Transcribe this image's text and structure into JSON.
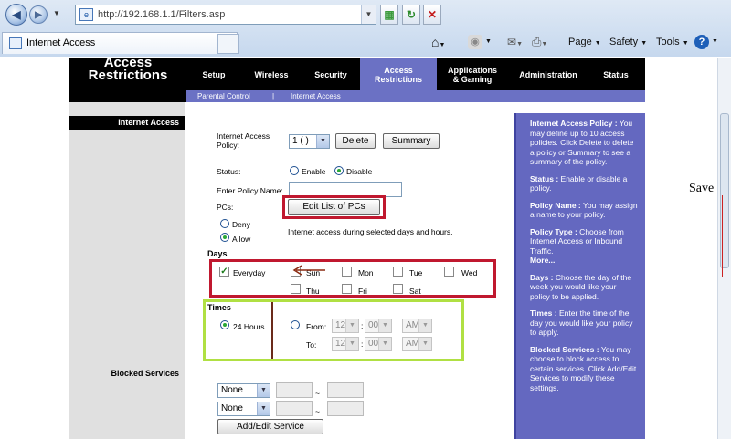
{
  "browser": {
    "address": "http://192.168.1.1/Filters.asp",
    "address_host": "http://192.168.1.1/",
    "address_path": "Filters.asp",
    "tab_title": "Internet Access",
    "commands": {
      "page": "Page",
      "safety": "Safety",
      "tools": "Tools",
      "help": "?"
    }
  },
  "router": {
    "section_title": "Access Restrictions",
    "tabs": [
      {
        "label": "Setup"
      },
      {
        "label": "Wireless"
      },
      {
        "label": "Security"
      },
      {
        "label": "Access Restrictions",
        "active": true
      },
      {
        "label": "Applications & Gaming"
      },
      {
        "label": "Administration"
      },
      {
        "label": "Status"
      }
    ],
    "subtabs": [
      "Parental Control",
      "|",
      "Internet Access"
    ],
    "side_label": "Internet Access",
    "blocked_services_label": "Blocked Services"
  },
  "form": {
    "policy_label": "Internet Access Policy:",
    "policy_value": "1 ( )",
    "delete_label": "Delete",
    "summary_label": "Summary",
    "status_label": "Status:",
    "enable_label": "Enable",
    "disable_label": "Disable",
    "status_selected": "Disable",
    "policy_name_label": "Enter Policy Name:",
    "policy_name_value": "",
    "pcs_label": "PCs:",
    "edit_pcs_label": "Edit List of PCs",
    "deny_label": "Deny",
    "allow_label": "Allow",
    "access_selected": "Allow",
    "access_note": "Internet access during selected days and hours.",
    "days_label": "Days",
    "days": {
      "everyday": {
        "label": "Everyday",
        "checked": true
      },
      "sun": {
        "label": "Sun",
        "checked": false
      },
      "mon": {
        "label": "Mon",
        "checked": false
      },
      "tue": {
        "label": "Tue",
        "checked": false
      },
      "wed": {
        "label": "Wed",
        "checked": false
      },
      "thu": {
        "label": "Thu",
        "checked": false
      },
      "fri": {
        "label": "Fri",
        "checked": false
      },
      "sat": {
        "label": "Sat",
        "checked": false
      }
    },
    "times_label": "Times",
    "hours24_label": "24 Hours",
    "from_label": "From:",
    "to_label": "To:",
    "from": {
      "hour": "12",
      "minute": "00",
      "ampm": "AM"
    },
    "to": {
      "hour": "12",
      "minute": "00",
      "ampm": "AM"
    },
    "colon": ":",
    "services": [
      {
        "value": "None",
        "tilde": "~"
      },
      {
        "value": "None",
        "tilde": "~"
      }
    ],
    "add_edit_service_label": "Add/Edit Service"
  },
  "help": {
    "paragraphs": [
      {
        "title": "Internet Access Policy :",
        "text": " You may define up to 10 access policies. Click Delete to delete a policy or Summary to see a summary of the policy."
      },
      {
        "title": "Status :",
        "text": " Enable or disable a policy."
      },
      {
        "title": "Policy Name :",
        "text": " You may assign a name to your policy."
      },
      {
        "title": "Policy Type :",
        "text": " Choose from Internet Access or Inbound Traffic."
      },
      {
        "title": "",
        "text": "More..."
      },
      {
        "title": "Days :",
        "text": " Choose the day of the week you would like your policy to be applied."
      },
      {
        "title": "Times :",
        "text": " Enter the time of the day you would like your policy to apply."
      },
      {
        "title": "Blocked Services :",
        "text": " You may choose to block access to certain services. Click Add/Edit Services to modify these settings."
      }
    ]
  },
  "annotation": {
    "save_text": "Save"
  }
}
